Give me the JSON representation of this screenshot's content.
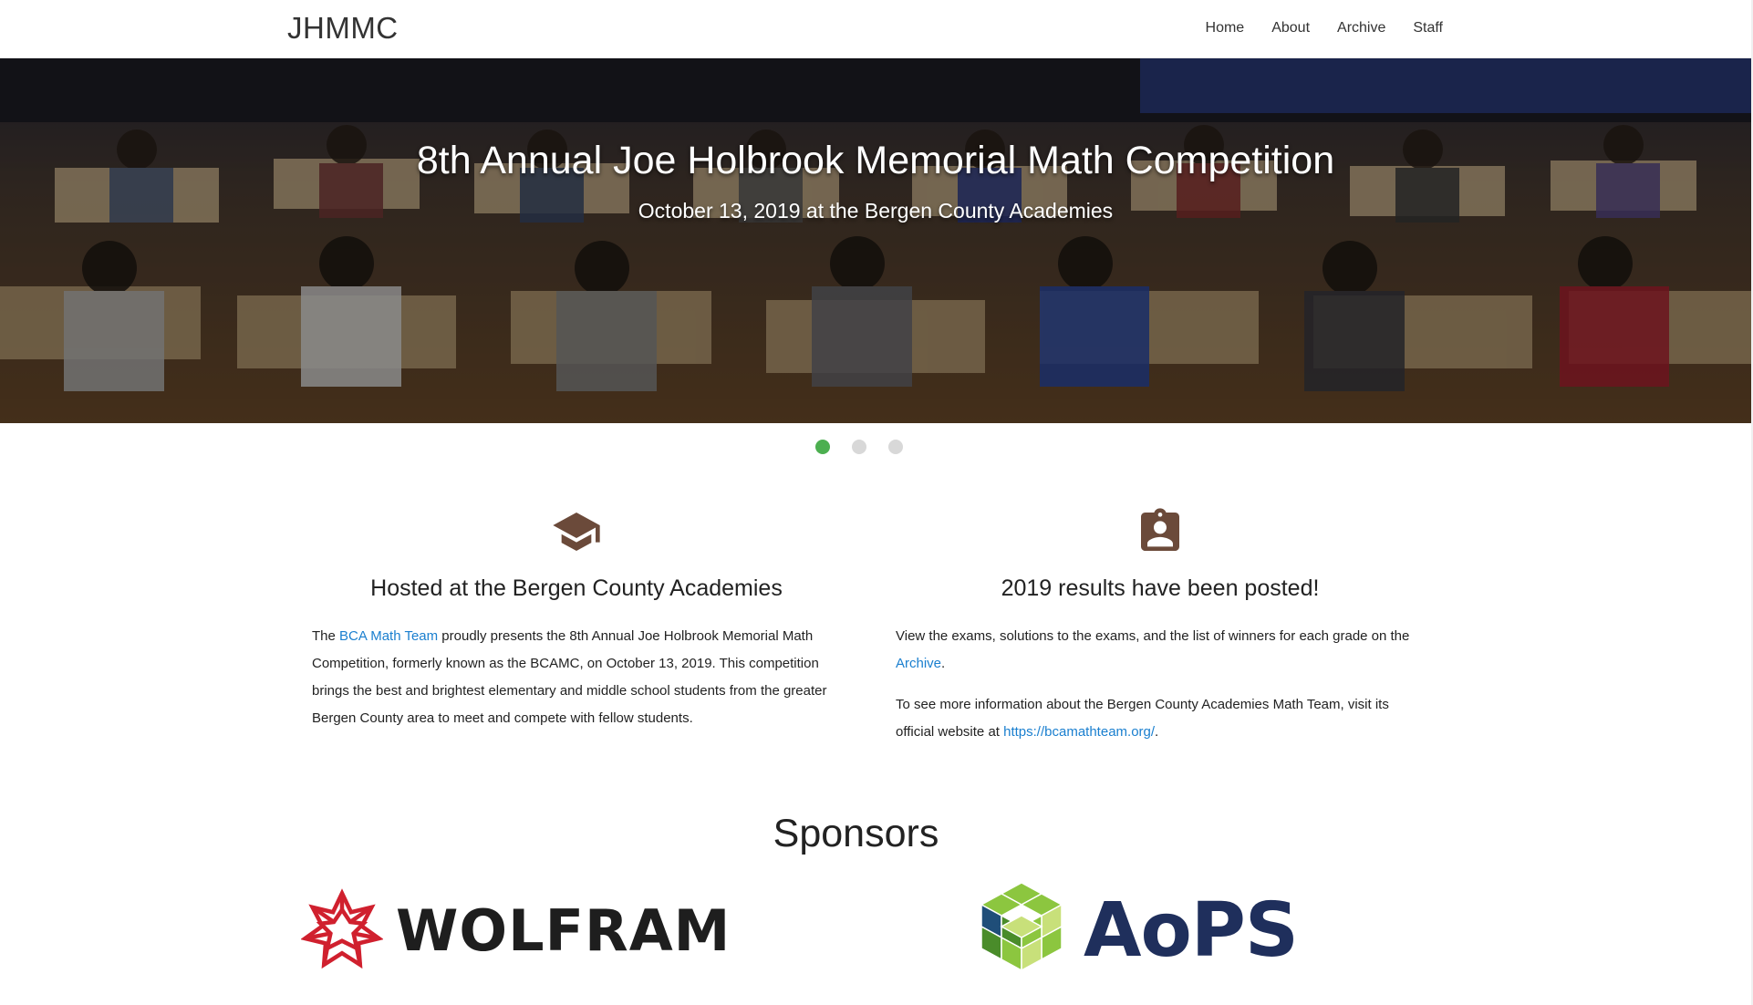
{
  "navbar": {
    "brand": "JHMMC",
    "links": [
      "Home",
      "About",
      "Archive",
      "Staff"
    ]
  },
  "hero": {
    "title": "8th Annual Joe Holbrook Memorial Math Competition",
    "subtitle": "October 13, 2019 at the Bergen County Academies",
    "slides": 3,
    "active_slide": 1
  },
  "features": {
    "left": {
      "icon": "graduation-cap-icon",
      "title": "Hosted at the Bergen County Academies",
      "body_prefix": "The ",
      "body_link": "BCA Math Team",
      "body_suffix": " proudly presents the 8th Annual Joe Holbrook Memorial Math Competition, formerly known as the BCAMC, on October 13, 2019. This competition brings the best and brightest elementary and middle school students from the greater Bergen County area to meet and compete with fellow students."
    },
    "right": {
      "icon": "clipboard-account-icon",
      "title": "2019 results have been posted!",
      "p1_prefix": "View the exams, solutions to the exams, and the list of winners for each grade on the ",
      "p1_link": "Archive",
      "p1_suffix": ".",
      "p2_prefix": "To see more information about the Bergen County Academies Math Team, visit its official website at ",
      "p2_link": "https://bcamathteam.org/",
      "p2_suffix": "."
    }
  },
  "sponsors": {
    "title": "Sponsors",
    "items": [
      {
        "name": "WOLFRAM",
        "color": "#d0202e"
      },
      {
        "name": "AoPS",
        "color": "#1f2f5c"
      }
    ]
  },
  "colors": {
    "accent": "#4caf50",
    "link": "#1a7fcf",
    "icon": "#6b4a3a"
  }
}
